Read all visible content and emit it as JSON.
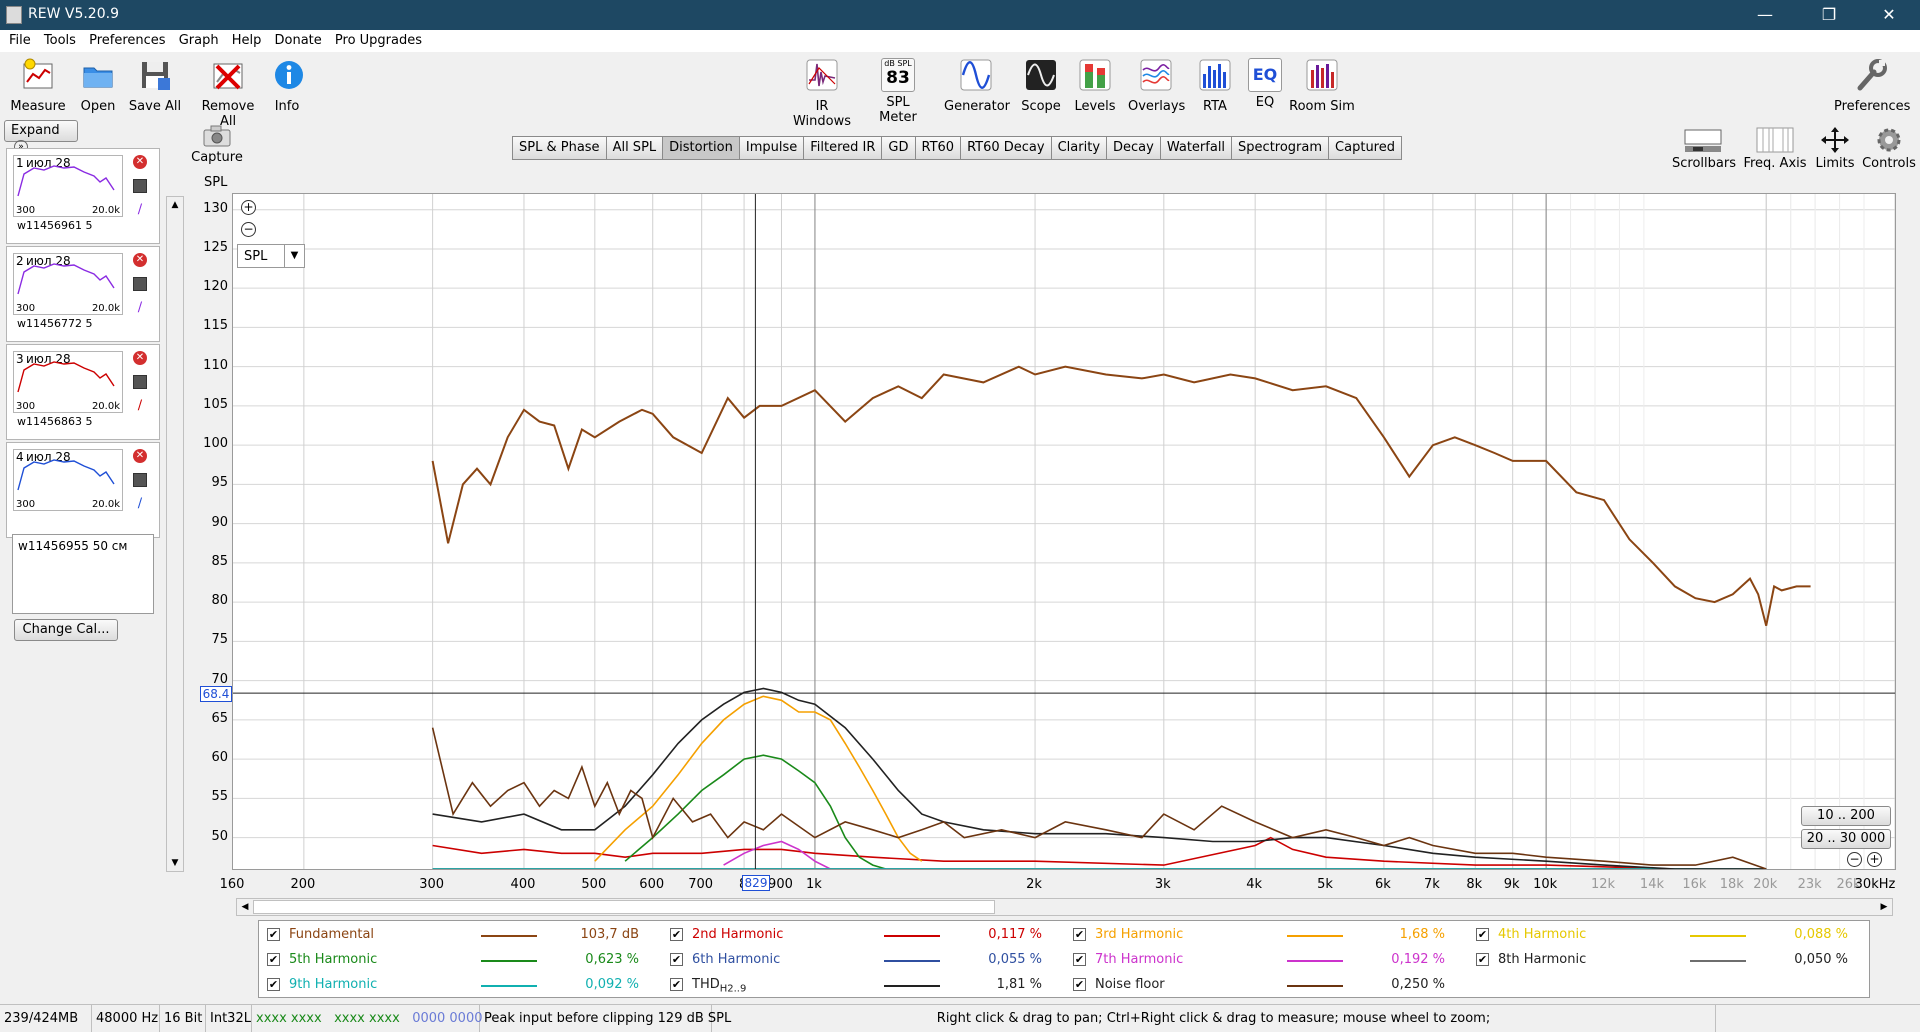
{
  "window": {
    "title": "REW V5.20.9",
    "minimize": "—",
    "maximize": "❐",
    "close": "✕"
  },
  "menu": [
    "File",
    "Tools",
    "Preferences",
    "Graph",
    "Help",
    "Donate",
    "Pro Upgrades"
  ],
  "toolbar_left": [
    "Measure",
    "Open",
    "Save All",
    "Remove All",
    "Info"
  ],
  "toolbar_center": [
    "IR Windows",
    "SPL Meter",
    "Generator",
    "Scope",
    "Levels",
    "Overlays",
    "RTA",
    "EQ",
    "Room Sim"
  ],
  "spl_meter_icon": {
    "top": "dB SPL",
    "value": "83"
  },
  "preferences_label": "Preferences",
  "capture_label": "Capture",
  "expand_label": "Expand",
  "tabs": [
    "SPL & Phase",
    "All SPL",
    "Distortion",
    "Impulse",
    "Filtered IR",
    "GD",
    "RT60",
    "RT60 Decay",
    "Clarity",
    "Decay",
    "Waterfall",
    "Spectrogram",
    "Captured"
  ],
  "active_tab": "Distortion",
  "right_tools": [
    "Scrollbars",
    "Freq. Axis",
    "Limits",
    "Controls"
  ],
  "measurements": [
    {
      "index": "1",
      "date": "июл 28",
      "name": "w11456961 5",
      "color": "#8a2be2",
      "ax_left": "300",
      "ax_right": "20.0k"
    },
    {
      "index": "2",
      "date": "июл 28",
      "name": "w11456772 5",
      "color": "#8a2be2",
      "ax_left": "300",
      "ax_right": "20.0k"
    },
    {
      "index": "3",
      "date": "июл 28",
      "name": "w11456863 5",
      "color": "#cc0000",
      "ax_left": "300",
      "ax_right": "20.0k"
    },
    {
      "index": "4",
      "date": "июл 28",
      "name": "",
      "color": "#1f4fd6",
      "ax_left": "300",
      "ax_right": "20.0k"
    }
  ],
  "selected_note": "w11456955 50 см",
  "change_cal_label": "Change Cal...",
  "plot": {
    "ylabel": "SPL",
    "dropdown": "SPL",
    "y_ticks": [
      "130",
      "125",
      "120",
      "115",
      "110",
      "105",
      "100",
      "95",
      "90",
      "85",
      "80",
      "75",
      "70",
      "65",
      "60",
      "55",
      "50"
    ],
    "x_ticks": [
      "160",
      "200",
      "300",
      "400",
      "500",
      "600",
      "700",
      "8",
      "900",
      "1k",
      "2k",
      "3k",
      "4k",
      "5k",
      "6k",
      "7k",
      "8k",
      "9k",
      "10k",
      "12k",
      "14k",
      "16k",
      "18k",
      "20k",
      "23k",
      "26k",
      "30kHz"
    ],
    "cursor_y": "68.4",
    "cursor_x": "829",
    "range_buttons": [
      "10 .. 200",
      "20 .. 30 000"
    ]
  },
  "chart_data": {
    "type": "line",
    "xlabel": "",
    "ylabel": "SPL",
    "x_scale": "log",
    "xlim": [
      160,
      30000
    ],
    "ylim": [
      46,
      132
    ],
    "series": [
      {
        "name": "Fundamental",
        "color": "#8b4513",
        "x": [
          300,
          315,
          330,
          345,
          360,
          380,
          400,
          420,
          440,
          460,
          480,
          500,
          540,
          580,
          600,
          640,
          700,
          760,
          800,
          840,
          900,
          1000,
          1100,
          1200,
          1300,
          1400,
          1500,
          1700,
          1900,
          2000,
          2200,
          2500,
          2800,
          3000,
          3300,
          3700,
          4000,
          4500,
          5000,
          5500,
          6000,
          6500,
          7000,
          7500,
          8000,
          8500,
          9000,
          10000,
          11000,
          12000,
          13000,
          14000,
          15000,
          16000,
          17000,
          18000,
          19000,
          19500,
          20000,
          20500,
          21000,
          22000,
          23000
        ],
        "y": [
          98,
          87.5,
          95,
          97,
          95,
          101,
          104.5,
          103,
          102.5,
          97,
          102,
          101,
          103,
          104.5,
          104,
          101,
          99,
          106,
          103.5,
          105,
          105,
          107,
          103,
          106,
          107.5,
          106,
          109,
          108,
          110,
          109,
          110,
          109,
          108.5,
          109,
          108,
          109,
          108.5,
          107,
          107.5,
          106,
          101,
          96,
          100,
          101,
          100,
          99,
          98,
          98,
          94,
          93,
          88,
          85,
          82,
          80.5,
          80,
          81,
          83,
          81,
          77,
          82,
          81.5,
          82,
          82
        ]
      },
      {
        "name": "2nd Harmonic",
        "color": "#cc0000",
        "x": [
          300,
          350,
          400,
          450,
          500,
          550,
          600,
          700,
          800,
          900,
          1000,
          1200,
          1500,
          2000,
          3000,
          4000,
          4200,
          4500,
          5000,
          6000,
          8000,
          10000,
          15000,
          20000
        ],
        "y": [
          49,
          48,
          48.5,
          48,
          48,
          47.5,
          48,
          48,
          48.5,
          48.5,
          48,
          47.5,
          47,
          47,
          46.5,
          49,
          50,
          48.5,
          47.5,
          47,
          46.5,
          46.5,
          46,
          46
        ]
      },
      {
        "name": "3rd Harmonic",
        "color": "#f5a000",
        "x": [
          500,
          550,
          600,
          650,
          700,
          750,
          800,
          850,
          900,
          950,
          1000,
          1050,
          1100,
          1150,
          1200,
          1250,
          1300,
          1350,
          1400
        ],
        "y": [
          47,
          51,
          54,
          58,
          62,
          65,
          67,
          68,
          67.5,
          66,
          66,
          65,
          62,
          59,
          56,
          53,
          50,
          48,
          47
        ]
      },
      {
        "name": "4th Harmonic",
        "color": "#e6c800",
        "x": [
          300,
          1000,
          10000,
          20000
        ],
        "y": [
          46,
          46,
          46,
          46
        ]
      },
      {
        "name": "5th Harmonic",
        "color": "#1a8a1a",
        "x": [
          550,
          600,
          650,
          700,
          750,
          800,
          850,
          900,
          950,
          1000,
          1050,
          1100,
          1150,
          1200,
          1250
        ],
        "y": [
          47,
          50,
          53,
          56,
          58,
          60,
          60.5,
          60,
          58.5,
          57,
          54,
          50,
          47.5,
          46.5,
          46
        ]
      },
      {
        "name": "6th Harmonic",
        "color": "#2f4fa0",
        "x": [
          300,
          1000,
          10000,
          20000
        ],
        "y": [
          46,
          46,
          46,
          46
        ]
      },
      {
        "name": "7th Harmonic",
        "color": "#cc33cc",
        "x": [
          750,
          800,
          850,
          900,
          950,
          1000,
          1050
        ],
        "y": [
          46.5,
          48,
          49,
          49.5,
          48.5,
          47,
          46
        ]
      },
      {
        "name": "8th Harmonic",
        "color": "#6e6e6e",
        "x": [
          300,
          1000,
          10000,
          20000
        ],
        "y": [
          46,
          46,
          46,
          46
        ]
      },
      {
        "name": "9th Harmonic",
        "color": "#10b0b0",
        "x": [
          300,
          1000,
          10000,
          20000
        ],
        "y": [
          46,
          46,
          46,
          46
        ]
      },
      {
        "name": "THD",
        "color": "#222222",
        "x": [
          300,
          350,
          400,
          450,
          500,
          550,
          600,
          650,
          700,
          750,
          800,
          850,
          900,
          950,
          1000,
          1100,
          1200,
          1300,
          1400,
          1500,
          1700,
          2000,
          2500,
          3000,
          3500,
          4000,
          4500,
          5000,
          6000,
          7000,
          8000,
          10000,
          12000,
          15000,
          20000
        ],
        "y": [
          53,
          52,
          53,
          51,
          51,
          54,
          58,
          62,
          65,
          67,
          68.5,
          69,
          68.5,
          67.5,
          67,
          64,
          60,
          56,
          53,
          52,
          51,
          50.5,
          50.5,
          50,
          49.5,
          49.5,
          50,
          50,
          49,
          48,
          47.5,
          47,
          46.5,
          46,
          46
        ]
      },
      {
        "name": "Noise floor",
        "color": "#6b3410",
        "x": [
          300,
          320,
          340,
          360,
          380,
          400,
          420,
          440,
          460,
          480,
          500,
          520,
          540,
          560,
          580,
          600,
          640,
          680,
          720,
          760,
          800,
          850,
          900,
          1000,
          1100,
          1200,
          1300,
          1400,
          1500,
          1600,
          1800,
          2000,
          2200,
          2500,
          2800,
          3000,
          3300,
          3600,
          4000,
          4500,
          5000,
          5500,
          6000,
          6500,
          7000,
          8000,
          9000,
          10000,
          12000,
          14000,
          16000,
          18000,
          20000
        ],
        "y": [
          64,
          53,
          57,
          54,
          56,
          57,
          54,
          56,
          55,
          59,
          54,
          57,
          53,
          56,
          55,
          50,
          55,
          52,
          53,
          50,
          52,
          51,
          53,
          50,
          52,
          51,
          50,
          51,
          52,
          50,
          51,
          50,
          52,
          51,
          50,
          53,
          51,
          54,
          52,
          50,
          51,
          50,
          49,
          50,
          49,
          48,
          48,
          47.5,
          47,
          46.5,
          46.5,
          47.5,
          46
        ]
      }
    ]
  },
  "legend": [
    {
      "name": "Fundamental",
      "value": "103,7 dB",
      "color": "#8b4513"
    },
    {
      "name": "2nd Harmonic",
      "value": "0,117 %",
      "color": "#cc0000"
    },
    {
      "name": "3rd Harmonic",
      "value": "1,68 %",
      "color": "#f5a000"
    },
    {
      "name": "4th Harmonic",
      "value": "0,088 %",
      "color": "#e6c800"
    },
    {
      "name": "5th Harmonic",
      "value": "0,623 %",
      "color": "#1a8a1a"
    },
    {
      "name": "6th Harmonic",
      "value": "0,055 %",
      "color": "#2f4fa0"
    },
    {
      "name": "7th Harmonic",
      "value": "0,192 %",
      "color": "#cc33cc"
    },
    {
      "name": "8th Harmonic",
      "value": "0,050 %",
      "color": "#6e6e6e"
    },
    {
      "name": "9th Harmonic",
      "value": "0,092 %",
      "color": "#10b0b0"
    },
    {
      "name": "THD",
      "sub": "H2..9",
      "value": "1,81 %",
      "color": "#222222"
    },
    {
      "name": "Noise floor",
      "value": "0,250 %",
      "color": "#6b3410"
    }
  ],
  "status": {
    "memory": "239/424MB",
    "rate": "48000 Hz",
    "bits": "16 Bit",
    "format": "Int32L",
    "green_a": "xxxx xxxx",
    "green_b": "xxxx xxxx",
    "blue": "0000 0000",
    "peak": "Peak input before clipping 129 dB SPL",
    "hint": "Right click & drag to pan; Ctrl+Right click & drag to measure; mouse wheel to zoom;"
  }
}
